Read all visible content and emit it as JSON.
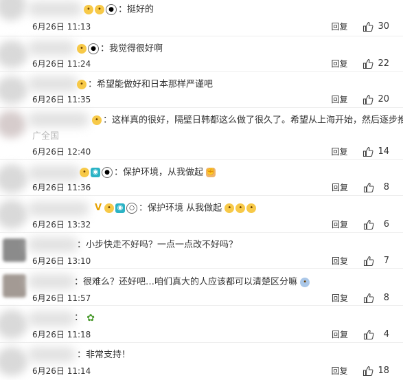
{
  "ui": {
    "reply_label": "回复"
  },
  "comments": [
    {
      "text": "：挺好的",
      "time": "6月26日 11:13",
      "likes": "30"
    },
    {
      "text": "：我觉得很好啊",
      "time": "6月26日 11:24",
      "likes": "22"
    },
    {
      "text": "：希望能做好和日本那样严谨吧",
      "time": "6月26日 11:35",
      "likes": "20"
    },
    {
      "text": "：这样真的很好，隔壁日韩都这么做了很久了。希望从上海开始，然后逐步推",
      "text2": "广全国",
      "time": "6月26日 12:40",
      "likes": "14"
    },
    {
      "text": "：保护环境，从我做起",
      "time": "6月26日 11:36",
      "likes": "8"
    },
    {
      "text": "：保护环境 从我做起",
      "time": "6月26日 13:32",
      "likes": "6"
    },
    {
      "text": "：小步快走不好吗？一点一点改不好吗？",
      "time": "6月26日 13:10",
      "likes": "7"
    },
    {
      "text": "：很难么？还好吧…咱们真大的人应该都可以清楚区分嘛",
      "time": "6月26日 11:57",
      "likes": "8"
    },
    {
      "text": "：",
      "time": "6月26日 11:18",
      "likes": "4"
    },
    {
      "text": "：非常支持！",
      "time": "6月26日 11:14",
      "likes": "18"
    }
  ]
}
